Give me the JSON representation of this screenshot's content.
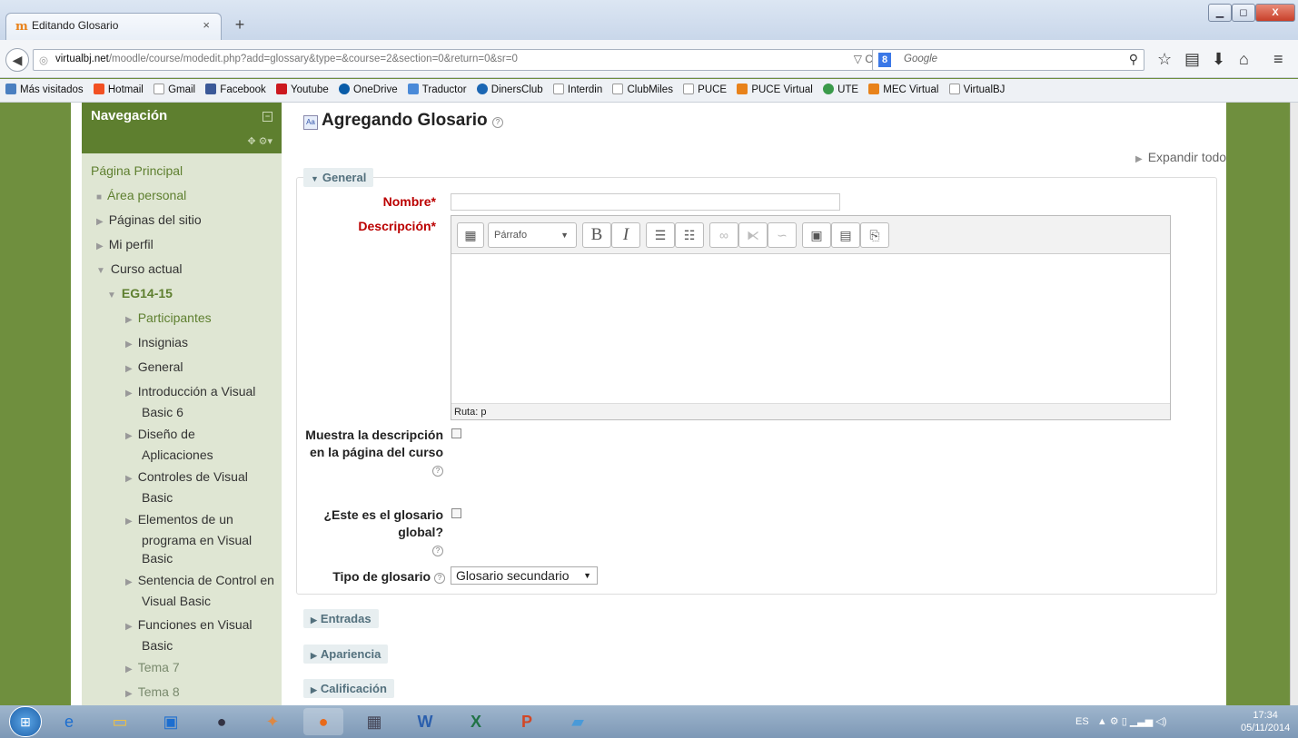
{
  "browser": {
    "tab_title": "Editando Glosario",
    "tab_close": "×",
    "new_tab": "+",
    "url_host": "virtualbj.net",
    "url_path": "/moodle/course/modedit.php?add=glossary&type=&course=2&section=0&return=0&sr=0",
    "search_placeholder": "Google",
    "window_buttons": [
      "▁",
      "◻",
      "X"
    ],
    "bookmarks": [
      "Más visitados",
      "Hotmail",
      "Gmail",
      "Facebook",
      "Youtube",
      "OneDrive",
      "Traductor",
      "DinersClub",
      "Interdin",
      "ClubMiles",
      "PUCE",
      "PUCE Virtual",
      "UTE",
      "MEC Virtual",
      "VirtualBJ"
    ]
  },
  "navigation": {
    "title": "Navegación",
    "home": "Página Principal",
    "personal_area": "Área personal",
    "site_pages": "Páginas del sitio",
    "profile": "Mi perfil",
    "current_course": "Curso actual",
    "course_code": "EG14-15",
    "items": [
      {
        "label": "Participantes"
      },
      {
        "label": "Insignias"
      },
      {
        "label": "General"
      },
      {
        "label": "Introducción a Visual Basic 6"
      },
      {
        "label": "Diseño de Aplicaciones"
      },
      {
        "label": "Controles de Visual Basic"
      },
      {
        "label": "Elementos de un programa en Visual Basic"
      },
      {
        "label": "Sentencia de Control en Visual Basic"
      },
      {
        "label": "Funciones en Visual Basic"
      },
      {
        "label": "Tema 7"
      },
      {
        "label": "Tema 8"
      }
    ]
  },
  "form": {
    "title": "Agregando Glosario",
    "expand_all": "Expandir todo",
    "section_general": "General",
    "name_label": "Nombre",
    "description_label": "Descripción",
    "paragraph_select": "Párrafo",
    "editor_path": "Ruta: p",
    "show_description_label": "Muestra la descripción en la página del curso",
    "global_label": "¿Este es el glosario global?",
    "type_label": "Tipo de glosario",
    "type_value": "Glosario secundario",
    "sections": [
      "Entradas",
      "Apariencia",
      "Calificación"
    ]
  },
  "taskbar": {
    "language": "ES",
    "time": "17:34",
    "date": "05/11/2014"
  }
}
